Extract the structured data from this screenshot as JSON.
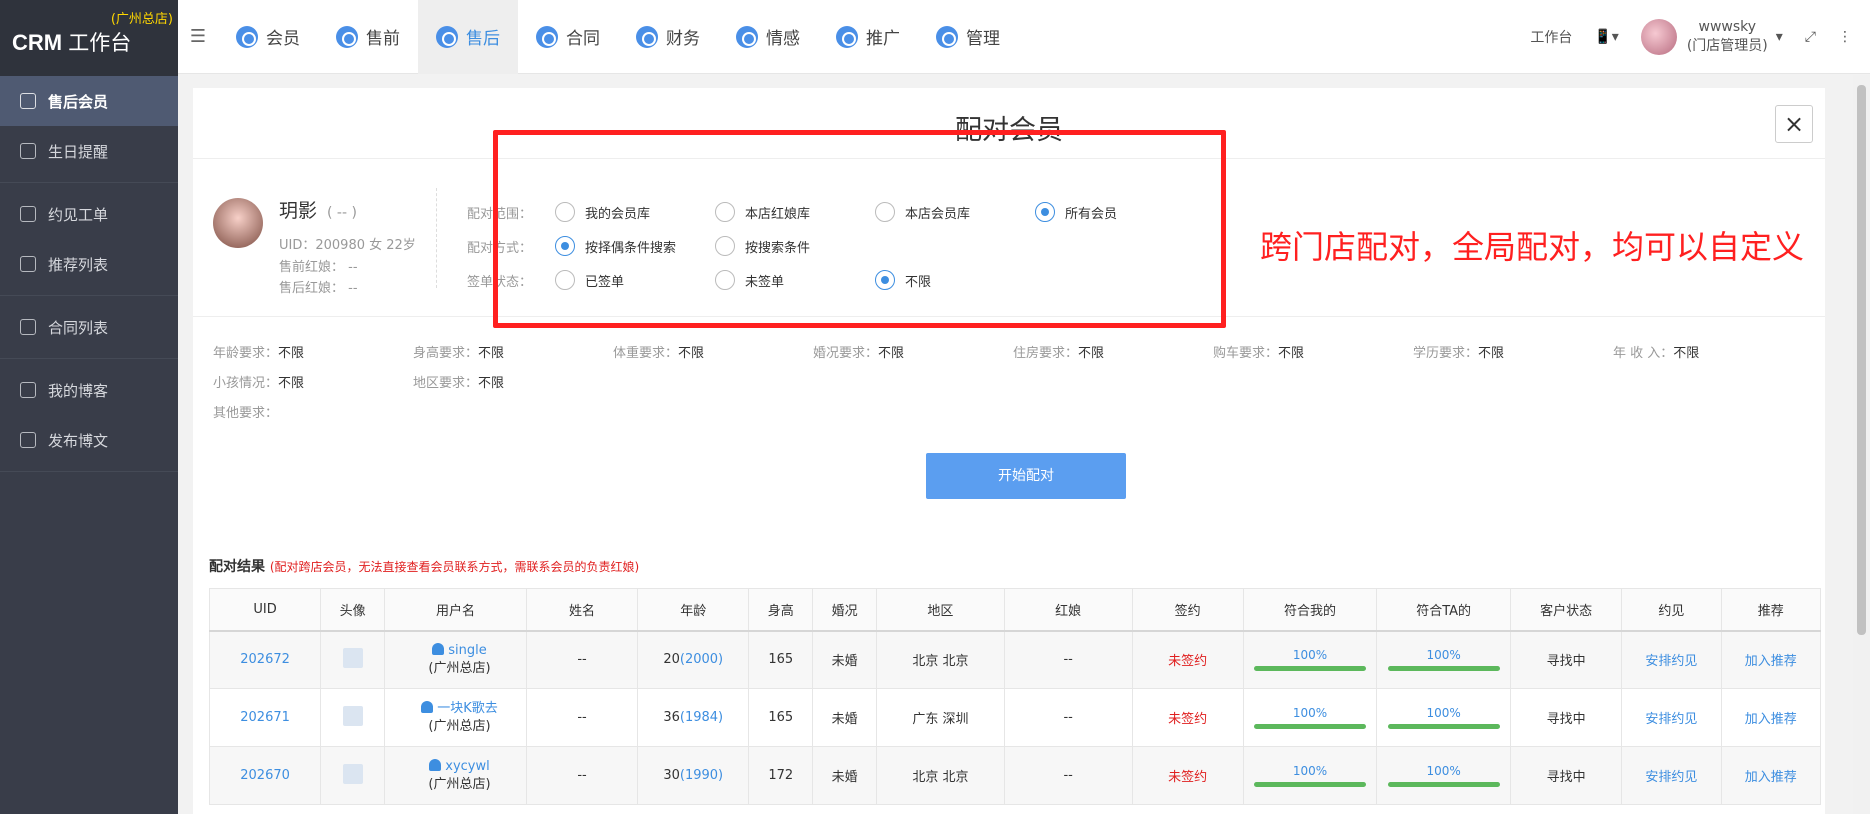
{
  "app": {
    "brand": "CRM",
    "brand_sub": "工作台",
    "branch": "(广州总店)"
  },
  "sidebar": {
    "groups": [
      [
        {
          "label": "售后会员",
          "active": true
        },
        {
          "label": "生日提醒"
        }
      ],
      [
        {
          "label": "约见工单"
        },
        {
          "label": "推荐列表"
        }
      ],
      [
        {
          "label": "合同列表"
        }
      ],
      [
        {
          "label": "我的博客"
        },
        {
          "label": "发布博文"
        }
      ]
    ]
  },
  "nav": {
    "items": [
      {
        "label": "会员"
      },
      {
        "label": "售前"
      },
      {
        "label": "售后",
        "active": true
      },
      {
        "label": "合同"
      },
      {
        "label": "财务"
      },
      {
        "label": "情感"
      },
      {
        "label": "推广"
      },
      {
        "label": "管理"
      }
    ],
    "workbench": "工作台",
    "user_name": "wwwsky",
    "user_role": "(门店管理员)"
  },
  "modal": {
    "title": "配对会员",
    "close": "×",
    "member": {
      "name": "玥影",
      "paren": "( -- )",
      "uid_line": "UID：200980 女 22岁",
      "pre_sales": "售前红娘：  --",
      "after_sales": "售后红娘：  --"
    },
    "options": [
      {
        "label": "配对范围：",
        "radios": [
          {
            "text": "我的会员库",
            "on": false
          },
          {
            "text": "本店红娘库",
            "on": false
          },
          {
            "text": "本店会员库",
            "on": false
          },
          {
            "text": "所有会员",
            "on": true
          }
        ]
      },
      {
        "label": "配对方式：",
        "radios": [
          {
            "text": "按择偶条件搜索",
            "on": true
          },
          {
            "text": "按搜索条件",
            "on": false
          }
        ]
      },
      {
        "label": "签单状态：",
        "radios": [
          {
            "text": "已签单",
            "on": false
          },
          {
            "text": "未签单",
            "on": false
          },
          {
            "text": "不限",
            "on": true
          }
        ]
      }
    ],
    "requirements": [
      [
        {
          "k": "年龄要求：",
          "v": "不限"
        },
        {
          "k": "身高要求：",
          "v": "不限"
        },
        {
          "k": "体重要求：",
          "v": "不限"
        },
        {
          "k": "婚况要求：",
          "v": "不限"
        },
        {
          "k": "住房要求：",
          "v": "不限"
        },
        {
          "k": "购车要求：",
          "v": "不限"
        },
        {
          "k": "学历要求：",
          "v": "不限"
        },
        {
          "k": "年  收  入：",
          "v": "不限"
        }
      ],
      [
        {
          "k": "小孩情况：",
          "v": "不限"
        },
        {
          "k": "地区要求：",
          "v": "不限"
        }
      ],
      [
        {
          "k": "其他要求：",
          "v": ""
        }
      ]
    ],
    "start_button": "开始配对",
    "result_title": "配对结果",
    "result_note": "(配对跨店会员，无法直接查看会员联系方式，需联系会员的负责红娘)",
    "table": {
      "headers": [
        "UID",
        "头像",
        "用户名",
        "姓名",
        "年龄",
        "身高",
        "婚况",
        "地区",
        "红娘",
        "签约",
        "符合我的",
        "符合TA的",
        "客户状态",
        "约见",
        "推荐"
      ],
      "rows": [
        {
          "uid": "202672",
          "username": "single",
          "store": "(广州总店)",
          "name": "--",
          "age": "20",
          "year": "(2000)",
          "height": "165",
          "marital": "未婚",
          "region": "北京 北京",
          "matchmaker": "--",
          "signed": "未签约",
          "mine": "100%",
          "ta": "100%",
          "mine_pct": 100,
          "ta_pct": 100,
          "status": "寻找中",
          "meet": "安排约见",
          "recommend": "加入推荐"
        },
        {
          "uid": "202671",
          "username": "一块K歌去",
          "store": "(广州总店)",
          "name": "--",
          "age": "36",
          "year": "(1984)",
          "height": "165",
          "marital": "未婚",
          "region": "广东 深圳",
          "matchmaker": "--",
          "signed": "未签约",
          "mine": "100%",
          "ta": "100%",
          "mine_pct": 100,
          "ta_pct": 100,
          "status": "寻找中",
          "meet": "安排约见",
          "recommend": "加入推荐"
        },
        {
          "uid": "202670",
          "username": "xycywl",
          "store": "(广州总店)",
          "name": "--",
          "age": "30",
          "year": "(1990)",
          "height": "172",
          "marital": "未婚",
          "region": "北京 北京",
          "matchmaker": "--",
          "signed": "未签约",
          "mine": "100%",
          "ta": "100%",
          "mine_pct": 100,
          "ta_pct": 100,
          "status": "寻找中",
          "meet": "安排约见",
          "recommend": "加入推荐"
        }
      ]
    }
  },
  "annotation": {
    "text": "跨门店配对，全局配对，均可以自定义",
    "color": "#ff2020"
  }
}
